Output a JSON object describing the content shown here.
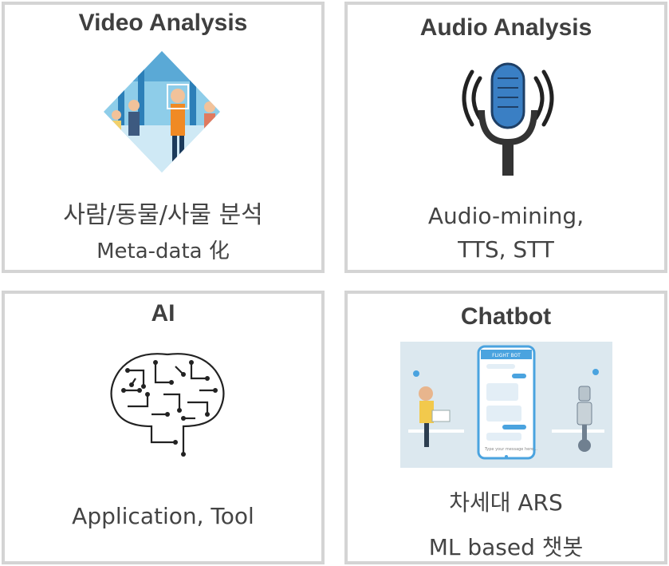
{
  "cards": [
    {
      "title": "Video Analysis",
      "lines": [
        "사람/동물/사물 분석",
        "Meta-data 化"
      ],
      "image": "people-analysis-illustration"
    },
    {
      "title": "Audio Analysis",
      "lines": [
        "Audio-mining,",
        "TTS, STT"
      ],
      "image": "microphone-icon"
    },
    {
      "title": "AI",
      "lines": [
        "Application, Tool"
      ],
      "image": "circuit-brain-icon"
    },
    {
      "title": "Chatbot",
      "lines": [
        "차세대 ARS",
        "ML based 챗봇"
      ],
      "image": "chatbot-illustration"
    }
  ],
  "chatbot_phone": {
    "header": "FLIGHT BOT",
    "input_placeholder": "Type your message here..."
  },
  "colors": {
    "border": "#d4d4d4",
    "title": "#3f3f3f",
    "text": "#444444",
    "mic_blue": "#3a7fc4",
    "chat_bg": "#dce8ef"
  }
}
